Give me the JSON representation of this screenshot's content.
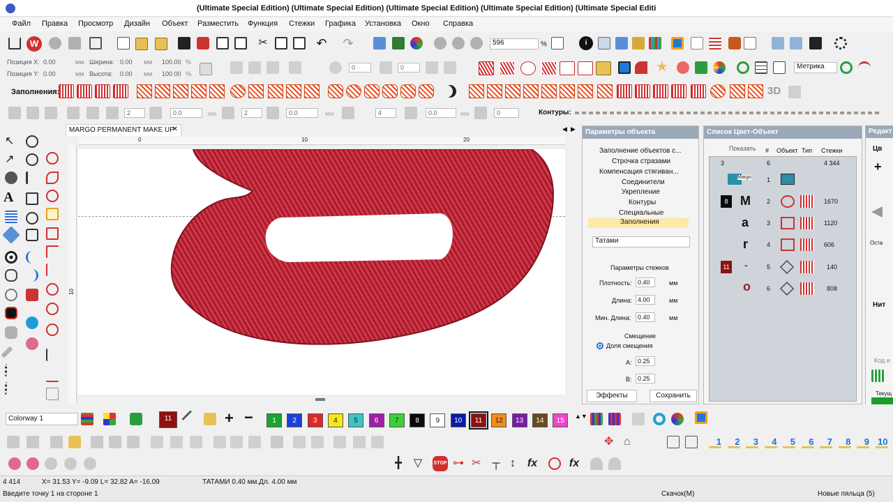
{
  "window": {
    "title": "(Ultimate Special Edition) (Ultimate Special Edition) (Ultimate Special Edition) (Ultimate Special Edition) (Ultimate Special Editi"
  },
  "menu": [
    {
      "label": "Файл"
    },
    {
      "label": "Правка"
    },
    {
      "label": "Просмотр"
    },
    {
      "label": "Дизайн"
    },
    {
      "label": "Объект"
    },
    {
      "label": "Разместить"
    },
    {
      "label": "Функция"
    },
    {
      "label": "Стежки"
    },
    {
      "label": "Графика"
    },
    {
      "label": "Установка"
    },
    {
      "label": "Окно"
    },
    {
      "label": "Справка"
    }
  ],
  "toolbar": {
    "zoom_value": "596",
    "zoom_unit": "%",
    "units_select": "Метрика"
  },
  "position": {
    "x_label": "Позиция X:",
    "x_value": "0.00",
    "y_label": "Позиция Y:",
    "y_value": "0.00",
    "mm": "мм",
    "width_label": "Ширина:",
    "width_value": "0.00",
    "height_label": "Высота:",
    "height_value": "0.00",
    "pct_a": "100.00",
    "pct_b": "100.00",
    "pct": "%"
  },
  "fills": {
    "label": "Заполнения:",
    "three_d": "3D"
  },
  "edit_toolbar": {
    "v1": "2",
    "v2": "0.0",
    "mm": "мм",
    "v3": "2",
    "v4": "0.0",
    "v5": "4",
    "v6": "0.0",
    "v7": "0",
    "contours_label": "Контуры:",
    "rotate_v1": "0",
    "rotate_v2": "0"
  },
  "document": {
    "tab": "MARGO PERMANENT MAKE UP",
    "ruler_0": "0",
    "ruler_10": "10",
    "ruler_20": "20",
    "ruler_v10": "10"
  },
  "object_params": {
    "title": "Параметры объекта",
    "tree": [
      "Заполнение объектов с...",
      "Строчка стразами",
      "Компенсация стягиван...",
      "Соединители",
      "Укрепление",
      "Контуры",
      "Специальные",
      "Заполнения"
    ],
    "fill_type": "Татами",
    "section": "Параметры стежков",
    "density_label": "Плотность:",
    "density": "0.40",
    "length_label": "Длина:",
    "length": "4.00",
    "minlen_label": "Мин. Длина:",
    "minlen": "0.40",
    "unit": "мм",
    "offset_title": "Смещение",
    "offset_radio": "Доля смещения",
    "a_label": "A:",
    "a_value": "0.25",
    "b_label": "B:",
    "b_value": "0.25",
    "effects_btn": "Эффекты",
    "save_btn": "Сохранить"
  },
  "color_list": {
    "title": "Список Цвет-Объект",
    "show_btn": "Показать",
    "col_num": "#",
    "col_obj": "Объект",
    "col_type": "Тип",
    "col_stitches": "Стежки",
    "summary_a": "3",
    "summary_b": "6",
    "summary_stitches": "4 344",
    "rows": [
      {
        "num": "1",
        "thumb": "Margo",
        "stitches": ""
      },
      {
        "color": "8",
        "glyph": "M",
        "num": "2",
        "stitches": "1670"
      },
      {
        "glyph": "a",
        "num": "3",
        "stitches": "1120"
      },
      {
        "glyph": "r",
        "num": "4",
        "stitches": "606"
      },
      {
        "color": "11",
        "glyph": "-",
        "num": "5",
        "stitches": "140"
      },
      {
        "glyph": "o",
        "num": "6",
        "stitches": "808"
      }
    ]
  },
  "right_panel": {
    "title": "Редакт",
    "tab_a": "Цв",
    "tab_b": "Нит",
    "small_a": "Оста",
    "small_b": "Код и",
    "small_c": "Текущ"
  },
  "colorway": {
    "select": "Colorway 1",
    "current": "11"
  },
  "swatches": [
    {
      "n": "1",
      "color": "#1aa531"
    },
    {
      "n": "2",
      "color": "#1d3fd8"
    },
    {
      "n": "3",
      "color": "#e02828"
    },
    {
      "n": "4",
      "color": "#f5e81a"
    },
    {
      "n": "5",
      "color": "#3bc6c6"
    },
    {
      "n": "6",
      "color": "#a021a8"
    },
    {
      "n": "7",
      "color": "#39d139"
    },
    {
      "n": "8",
      "color": "#0a0a0a"
    },
    {
      "n": "9",
      "color": "#ffffff"
    },
    {
      "n": "10",
      "color": "#0b1aa8"
    },
    {
      "n": "11",
      "color": "#8e1111"
    },
    {
      "n": "12",
      "color": "#f28c1a"
    },
    {
      "n": "13",
      "color": "#7a1aa8"
    },
    {
      "n": "14",
      "color": "#6b4a21"
    },
    {
      "n": "15",
      "color": "#ee46c8"
    }
  ],
  "sequence": [
    "1",
    "2",
    "3",
    "4",
    "5",
    "6",
    "7",
    "8",
    "9",
    "10"
  ],
  "status": {
    "count": "4 414",
    "coords": "X= 31.53 Y= -9.09 L= 32.82 A= -16.09",
    "stitch_info": "ТАТАМИ 0.40 мм.Дл. 4.00 мм",
    "prompt": "Введите точку 1 на стороне 1",
    "download": "Скачок(M)",
    "hoop": "Новые пяльца (5)"
  },
  "colors": {
    "embroidery": "#b5212e",
    "panel_head": "#9aa8b8",
    "accent_red": "#d32f2f"
  }
}
